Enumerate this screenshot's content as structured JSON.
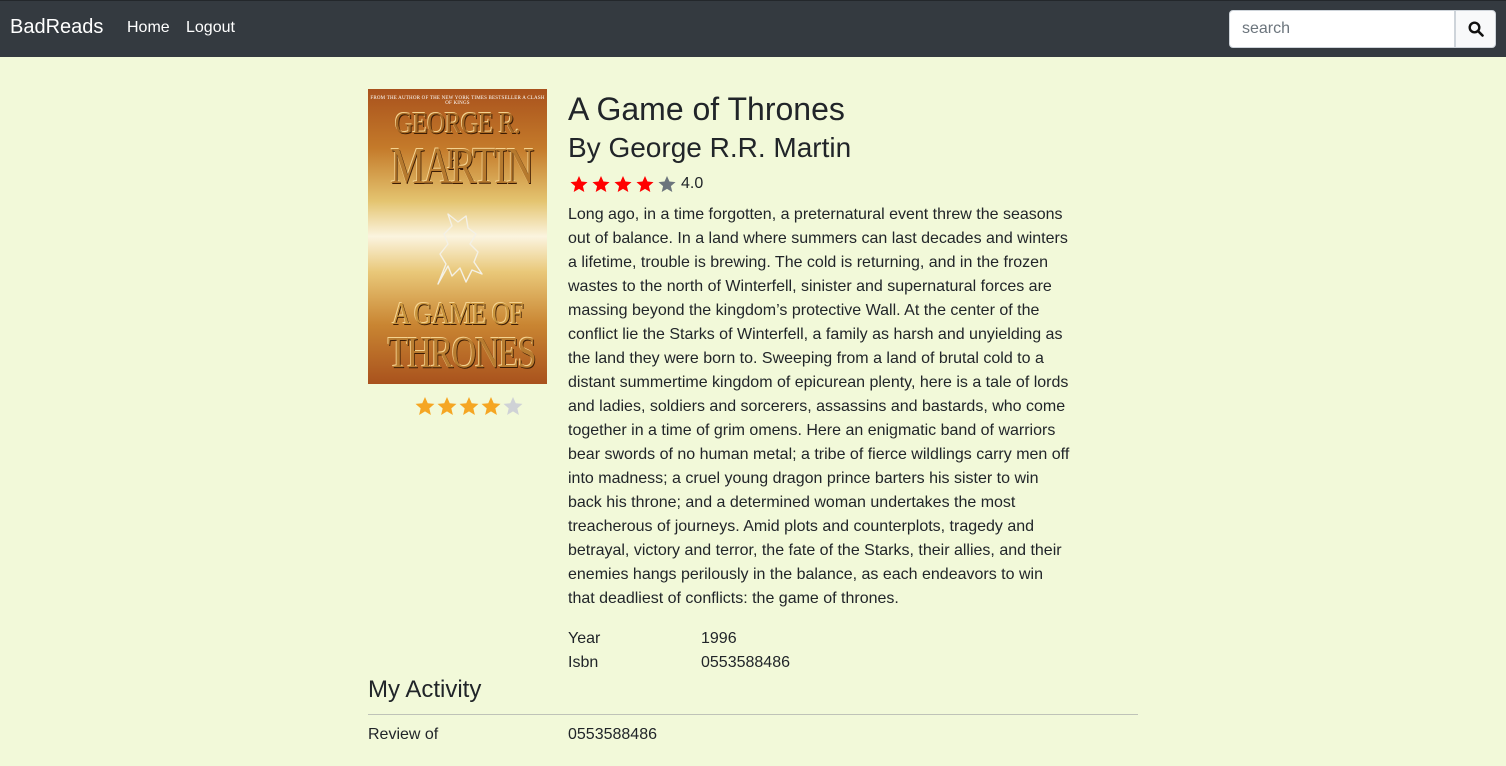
{
  "nav": {
    "brand": "BadReads",
    "links": [
      "Home",
      "Logout"
    ],
    "search": {
      "placeholder": "search",
      "value": ""
    }
  },
  "book": {
    "cover": {
      "top_line": "FROM THE AUTHOR OF THE NEW YORK TIMES BESTSELLER A CLASH OF KINGS",
      "author_line1": "GEORGE R. R.",
      "author_line2": "MARTIN",
      "title_line1": "A GAME OF",
      "title_line2": "THRONES"
    },
    "title": "A Game of Thrones",
    "author": "By George R.R. Martin",
    "user_rating": 4,
    "user_rating_max": 5,
    "average_rating": 4,
    "average_rating_text": "4.0",
    "description": "Long ago, in a time forgotten, a preternatural event threw the seasons out of balance. In a land where summers can last decades and winters a lifetime, trouble is brewing. The cold is returning, and in the frozen wastes to the north of Winterfell, sinister and supernatural forces are massing beyond the kingdom’s protective Wall. At the center of the conflict lie the Starks of Winterfell, a family as harsh and unyielding as the land they were born to. Sweeping from a land of brutal cold to a distant summertime kingdom of epicurean plenty, here is a tale of lords and ladies, soldiers and sorcerers, assassins and bastards, who come together in a time of grim omens. Here an enigmatic band of warriors bear swords of no human metal; a tribe of fierce wildlings carry men off into madness; a cruel young dragon prince barters his sister to win back his throne; and a determined woman undertakes the most treacherous of journeys. Amid plots and counterplots, tragedy and betrayal, victory and terror, the fate of the Starks, their allies, and their enemies hangs perilously in the balance, as each endeavors to win that deadliest of conflicts: the game of thrones.",
    "details": [
      {
        "label": "Year",
        "value": "1996"
      },
      {
        "label": "Isbn",
        "value": "0553588486"
      }
    ]
  },
  "activity": {
    "title": "My Activity",
    "rows": [
      {
        "label": "Review of",
        "value": "0553588486"
      }
    ]
  },
  "colors": {
    "navbar": "#343a40",
    "background": "#f2f9d9",
    "user_star_filled": "#f5a623",
    "user_star_empty": "#cfd2d6",
    "avg_star_filled": "#ff0000",
    "avg_star_empty": "#6c757d"
  },
  "icons": {
    "search": "search-icon",
    "star": "star-icon"
  }
}
